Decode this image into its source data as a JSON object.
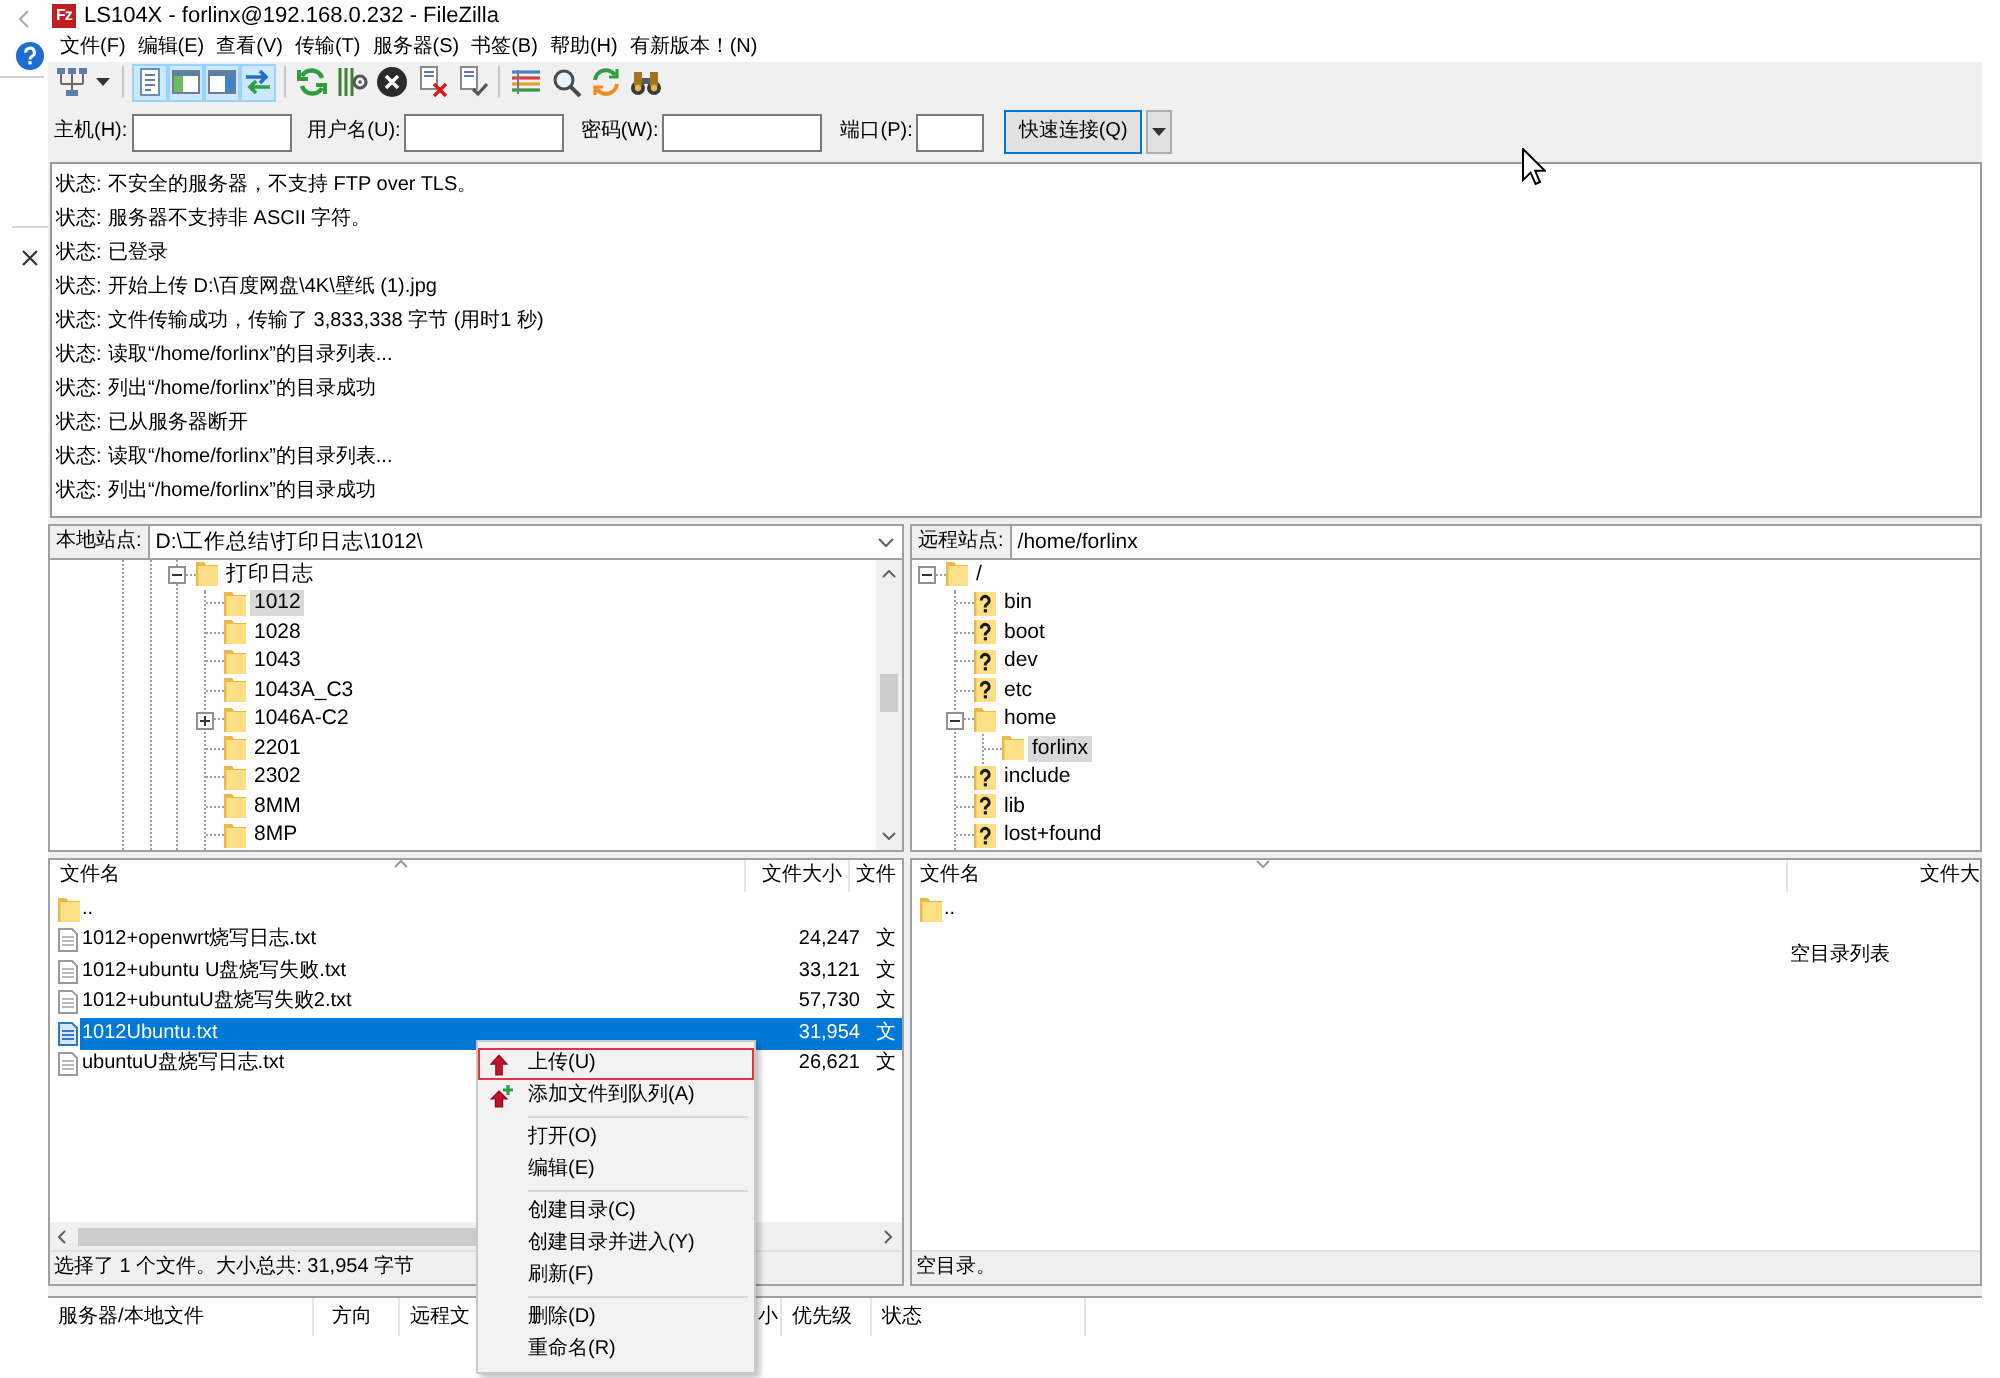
{
  "window": {
    "logo": "Fz",
    "title": "LS104X - forlinx@192.168.0.232 - FileZilla"
  },
  "menu_bar": [
    "文件(F)",
    "编辑(E)",
    "查看(V)",
    "传输(T)",
    "服务器(S)",
    "书签(B)",
    "帮助(H)",
    "有新版本！(N)"
  ],
  "toolbar": {
    "view_toggles": [
      {
        "on": true
      },
      {
        "on": true
      },
      {
        "on": true
      },
      {
        "on": true
      }
    ]
  },
  "quickconnect": {
    "fields": [
      {
        "label": "主机(H):"
      },
      {
        "label": "用户名(U):"
      },
      {
        "label": "密码(W):"
      },
      {
        "label": "端口(P):"
      }
    ],
    "button": "快速连接(Q)"
  },
  "message_log": [
    {
      "label": "状态:",
      "message": "不安全的服务器，不支持 FTP over TLS。"
    },
    {
      "label": "状态:",
      "message": "服务器不支持非 ASCII 字符。"
    },
    {
      "label": "状态:",
      "message": "已登录"
    },
    {
      "label": "状态:",
      "message": "开始上传 D:\\百度网盘\\4K\\壁纸 (1).jpg"
    },
    {
      "label": "状态:",
      "message": "文件传输成功，传输了 3,833,338 字节 (用时1 秒)"
    },
    {
      "label": "状态:",
      "message": "读取“/home/forlinx”的目录列表..."
    },
    {
      "label": "状态:",
      "message": "列出“/home/forlinx”的目录成功"
    },
    {
      "label": "状态:",
      "message": "已从服务器断开"
    },
    {
      "label": "状态:",
      "message": "读取“/home/forlinx”的目录列表..."
    },
    {
      "label": "状态:",
      "message": "列出“/home/forlinx”的目录成功"
    }
  ],
  "local_site": {
    "label": "本地站点:",
    "path": "D:\\工作总结\\打印日志\\1012\\"
  },
  "local_tree": [
    {
      "label": "打印日志",
      "kind": "folder",
      "selected": false,
      "expanded": true,
      "children": [
        {
          "label": "1012",
          "kind": "folder",
          "selected": true
        },
        {
          "label": "1028",
          "kind": "folder",
          "selected": false
        },
        {
          "label": "1043",
          "kind": "folder",
          "selected": false
        },
        {
          "label": "1043A_C3",
          "kind": "folder",
          "selected": false
        },
        {
          "label": "1046A-C2",
          "kind": "folder",
          "selected": false,
          "expanded": false
        },
        {
          "label": "2201",
          "kind": "folder",
          "selected": false
        },
        {
          "label": "2302",
          "kind": "folder",
          "selected": false
        },
        {
          "label": "8MM",
          "kind": "folder",
          "selected": false
        },
        {
          "label": "8MP",
          "kind": "folder",
          "selected": false
        }
      ]
    }
  ],
  "local_files": {
    "columns": [
      "文件名",
      "文件大小",
      "文件"
    ],
    "rows": [
      {
        "kind": "folder",
        "name": "..",
        "selected": false
      },
      {
        "kind": "file",
        "name": "1012+openwrt烧写日志.txt",
        "size": "24,247",
        "column_3": "文",
        "selected": false
      },
      {
        "kind": "file",
        "name": "1012+ubuntu U盘烧写失败.txt",
        "size": "33,121",
        "column_3": "文",
        "selected": false
      },
      {
        "kind": "file",
        "name": "1012+ubuntuU盘烧写失败2.txt",
        "size": "57,730",
        "column_3": "文",
        "selected": false
      },
      {
        "kind": "file",
        "name": "1012Ubuntu.txt",
        "size": "31,954",
        "column_3": "文",
        "selected": true
      },
      {
        "kind": "file",
        "name": "ubuntuU盘烧写日志.txt",
        "size": "26,621",
        "column_3": "文",
        "selected": false
      }
    ],
    "status": "选择了 1 个文件。大小总共: 31,954 字节"
  },
  "remote_site": {
    "label": "远程站点:",
    "path": "/home/forlinx"
  },
  "remote_tree": [
    {
      "label": "/",
      "kind": "folder",
      "selected": false,
      "expanded": true,
      "children": [
        {
          "label": "bin",
          "kind": "unknown",
          "selected": false
        },
        {
          "label": "boot",
          "kind": "unknown",
          "selected": false
        },
        {
          "label": "dev",
          "kind": "unknown",
          "selected": false
        },
        {
          "label": "etc",
          "kind": "unknown",
          "selected": false
        },
        {
          "label": "home",
          "kind": "folder",
          "selected": false,
          "expanded": true,
          "children": [
            {
              "label": "forlinx",
              "kind": "folder",
              "selected": true
            }
          ]
        },
        {
          "label": "include",
          "kind": "unknown",
          "selected": false
        },
        {
          "label": "lib",
          "kind": "unknown",
          "selected": false
        },
        {
          "label": "lost+found",
          "kind": "unknown",
          "selected": false
        }
      ]
    }
  ],
  "remote_files": {
    "columns": [
      "文件名",
      "文件大"
    ],
    "rows": [
      {
        "kind": "folder",
        "name": "..",
        "selected": false
      }
    ],
    "empty_message": "空目录列表",
    "status": "空目录。"
  },
  "queue": {
    "columns": [
      "服务器/本地文件",
      "方向",
      "远程文",
      "小",
      "优先级",
      "状态"
    ]
  },
  "context_menu": {
    "items": [
      {
        "kind": "upload",
        "label": "上传(U)",
        "selected": true
      },
      {
        "kind": "enqueue",
        "label": "添加文件到队列(A)",
        "selected": false
      },
      {
        "kind": "separator"
      },
      {
        "kind": "plain",
        "label": "打开(O)",
        "selected": false
      },
      {
        "kind": "plain",
        "label": "编辑(E)",
        "selected": false
      },
      {
        "kind": "separator"
      },
      {
        "kind": "plain",
        "label": "创建目录(C)",
        "selected": false
      },
      {
        "kind": "plain",
        "label": "创建目录并进入(Y)",
        "selected": false
      },
      {
        "kind": "plain",
        "label": "刷新(F)",
        "selected": false
      },
      {
        "kind": "separator"
      },
      {
        "kind": "plain",
        "label": "删除(D)",
        "selected": false
      },
      {
        "kind": "plain",
        "label": "重命名(R)",
        "selected": false
      }
    ]
  }
}
